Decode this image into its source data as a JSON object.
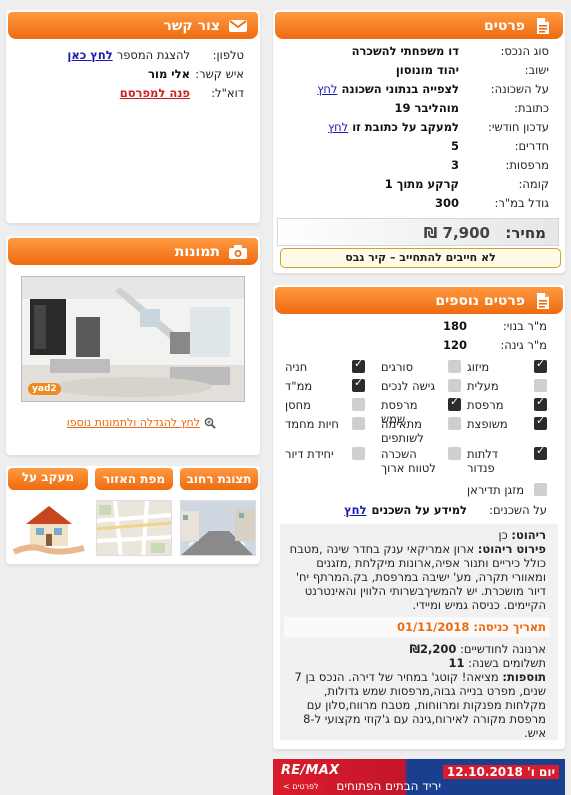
{
  "details": {
    "title": "פרטים",
    "rows": [
      {
        "label": "סוג הנכס:",
        "value": "דו משפחתי להשכרה"
      },
      {
        "label": "ישוב:",
        "value": "יהוד מונוסון"
      },
      {
        "label": "על השכונה:",
        "value": "לצפייה בנתוני השכונה",
        "link": "לחץ"
      },
      {
        "label": "כתובת:",
        "value": "מוהליבר 19"
      },
      {
        "label": "עדכון חודשי:",
        "value": "למעקב על כתובת זו",
        "link": "לחץ"
      },
      {
        "label": "חדרים:",
        "value": "5"
      },
      {
        "label": "מרפסות:",
        "value": "3"
      },
      {
        "label": "קומה:",
        "value": "קרקע מתוך 1"
      },
      {
        "label": "גודל במ\"ר:",
        "value": "300"
      }
    ],
    "price_label": "מחיר:",
    "price_value": "7,900 ₪",
    "notice": "לא חייבים להתחייב – קיר גבס"
  },
  "contact": {
    "title": "צור קשר",
    "phone_label": "טלפון:",
    "phone_text": "להצגת המספר",
    "phone_link": "לחץ כאן",
    "person_label": "איש קשר:",
    "person_value": "אלי מור",
    "email_label": "דוא\"ל:",
    "email_link": "פנה למפרסם"
  },
  "images": {
    "title": "תמונות",
    "watermark": "yad2",
    "enlarge_link": "לחץ להגדלה ולתמונות נוספו"
  },
  "tabs": {
    "street_view": "תצוגת רחוב",
    "area_map": "מפת האזור",
    "track_prices": "מעקב על מחירים"
  },
  "more": {
    "title": "פרטים נוספים",
    "built_label": "מ\"ר בנוי:",
    "built_value": "180",
    "garden_label": "מ\"ר גינה:",
    "garden_value": "120",
    "features": [
      {
        "label": "מיזוג",
        "on": true
      },
      {
        "label": "סורגים",
        "on": false
      },
      {
        "label": "חניה",
        "on": true
      },
      {
        "label": "מעלית",
        "on": false
      },
      {
        "label": "גישה לנכים",
        "on": false
      },
      {
        "label": "ממ\"ד",
        "on": true
      },
      {
        "label": "מרפסת",
        "on": true
      },
      {
        "label": "מרפסת שמש",
        "on": true
      },
      {
        "label": "מחסן",
        "on": false
      },
      {
        "label": "משופצת",
        "on": true
      },
      {
        "label": "מתאימה לשותפים",
        "on": false
      },
      {
        "label": "חיות מחמד",
        "on": false
      },
      {
        "label": "דלתות פנדור",
        "on": true
      },
      {
        "label": "השכרה לטווח ארוך",
        "on": false
      },
      {
        "label": "יחידת דיור",
        "on": false
      },
      {
        "label": "מזגן תדיראן",
        "on": false
      }
    ],
    "neighbors_label": "על השכנים:",
    "neighbors_text": "למידע על השכנים",
    "neighbors_link": "לחץ",
    "furniture_label": "ריהוט:",
    "furniture_value": "כן",
    "furniture_desc_label": "פירוט ריהוט:",
    "furniture_desc": "ארון אמריקאי ענק בחדר שינה ,מטבח כולל כיריים ותנור אפיה,ארונות מיקלחת ,מזגנים ומאוורי תקרה, מע' ישיבה במרפסת, בק.המרתף יח' דיור מושכרת. יש להמשיךבשרותי הלווין והאינטרנט הקיימים. כניסה גמיש ומיידי.",
    "entry_label": "תאריך כניסה:",
    "entry_value": "01/11/2018",
    "arnona_label": "ארנונה לחודשיים:",
    "arnona_value": "₪2,200",
    "payments_label": "תשלומים בשנה:",
    "payments_value": "11",
    "extras_label": "תוספות:",
    "extras_text": "מציאה! קוטג' במחיר של דירה. הנכס בן 7 שנים, מפרט בנייה גבוה,מרפסות שמש גדולות, מקלחות מפנקות ומרווחות, מטבח מרווח,סלון עם מרפסת מקורה לאירוח,גינה עם ג'קוזי מקצועי ל-8 איש."
  },
  "banner": {
    "brand": "RE/MAX",
    "date_text": "יום ו' 12.10.2018",
    "caption": "יריד הבתים הפתוחים",
    "details_btn": "לפרטים >"
  },
  "colors": {
    "accent": "#ee6a10",
    "link": "#1a1ab0",
    "remax_blue": "#1b3f8f",
    "remax_red": "#d91c2b"
  }
}
